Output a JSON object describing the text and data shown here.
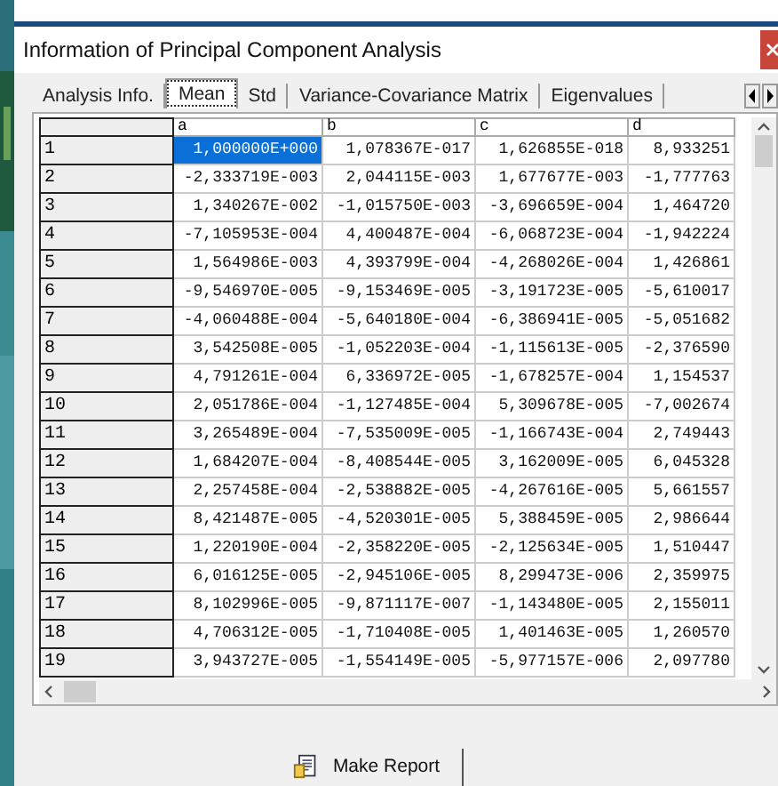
{
  "window": {
    "title": "Information of Principal Component Analysis"
  },
  "tabs": [
    {
      "label": "Analysis Info.",
      "selected": false
    },
    {
      "label": "Mean",
      "selected": true
    },
    {
      "label": "Std",
      "selected": false
    },
    {
      "label": "Variance-Covariance Matrix",
      "selected": false
    },
    {
      "label": "Eigenvalues",
      "selected": false
    }
  ],
  "table": {
    "columns": [
      "a",
      "b",
      "c",
      "d"
    ],
    "rows": [
      {
        "header": "1",
        "cells": [
          {
            "text": "1,000000E+000",
            "selected": true
          },
          {
            "text": "1,078367E-017",
            "selected": false
          },
          {
            "text": "1,626855E-018",
            "selected": false
          },
          {
            "text": "8,933251",
            "selected": false
          }
        ]
      },
      {
        "header": "2",
        "cells": [
          {
            "text": "-2,333719E-003",
            "selected": false
          },
          {
            "text": "2,044115E-003",
            "selected": false
          },
          {
            "text": "1,677677E-003",
            "selected": false
          },
          {
            "text": "-1,777763",
            "selected": false
          }
        ]
      },
      {
        "header": "3",
        "cells": [
          {
            "text": "1,340267E-002",
            "selected": false
          },
          {
            "text": "-1,015750E-003",
            "selected": false
          },
          {
            "text": "-3,696659E-004",
            "selected": false
          },
          {
            "text": "1,464720",
            "selected": false
          }
        ]
      },
      {
        "header": "4",
        "cells": [
          {
            "text": "-7,105953E-004",
            "selected": false
          },
          {
            "text": "4,400487E-004",
            "selected": false
          },
          {
            "text": "-6,068723E-004",
            "selected": false
          },
          {
            "text": "-1,942224",
            "selected": false
          }
        ]
      },
      {
        "header": "5",
        "cells": [
          {
            "text": "1,564986E-003",
            "selected": false
          },
          {
            "text": "4,393799E-004",
            "selected": false
          },
          {
            "text": "-4,268026E-004",
            "selected": false
          },
          {
            "text": "1,426861",
            "selected": false
          }
        ]
      },
      {
        "header": "6",
        "cells": [
          {
            "text": "-9,546970E-005",
            "selected": false
          },
          {
            "text": "-9,153469E-005",
            "selected": false
          },
          {
            "text": "-3,191723E-005",
            "selected": false
          },
          {
            "text": "-5,610017",
            "selected": false
          }
        ]
      },
      {
        "header": "7",
        "cells": [
          {
            "text": "-4,060488E-004",
            "selected": false
          },
          {
            "text": "-5,640180E-004",
            "selected": false
          },
          {
            "text": "-6,386941E-005",
            "selected": false
          },
          {
            "text": "-5,051682",
            "selected": false
          }
        ]
      },
      {
        "header": "8",
        "cells": [
          {
            "text": "3,542508E-005",
            "selected": false
          },
          {
            "text": "-1,052203E-004",
            "selected": false
          },
          {
            "text": "-1,115613E-005",
            "selected": false
          },
          {
            "text": "-2,376590",
            "selected": false
          }
        ]
      },
      {
        "header": "9",
        "cells": [
          {
            "text": "4,791261E-004",
            "selected": false
          },
          {
            "text": "6,336972E-005",
            "selected": false
          },
          {
            "text": "-1,678257E-004",
            "selected": false
          },
          {
            "text": "1,154537",
            "selected": false
          }
        ]
      },
      {
        "header": "10",
        "cells": [
          {
            "text": "2,051786E-004",
            "selected": false
          },
          {
            "text": "-1,127485E-004",
            "selected": false
          },
          {
            "text": "5,309678E-005",
            "selected": false
          },
          {
            "text": "-7,002674",
            "selected": false
          }
        ]
      },
      {
        "header": "11",
        "cells": [
          {
            "text": "3,265489E-004",
            "selected": false
          },
          {
            "text": "-7,535009E-005",
            "selected": false
          },
          {
            "text": "-1,166743E-004",
            "selected": false
          },
          {
            "text": "2,749443",
            "selected": false
          }
        ]
      },
      {
        "header": "12",
        "cells": [
          {
            "text": "1,684207E-004",
            "selected": false
          },
          {
            "text": "-8,408544E-005",
            "selected": false
          },
          {
            "text": "3,162009E-005",
            "selected": false
          },
          {
            "text": "6,045328",
            "selected": false
          }
        ]
      },
      {
        "header": "13",
        "cells": [
          {
            "text": "2,257458E-004",
            "selected": false
          },
          {
            "text": "-2,538882E-005",
            "selected": false
          },
          {
            "text": "-4,267616E-005",
            "selected": false
          },
          {
            "text": "5,661557",
            "selected": false
          }
        ]
      },
      {
        "header": "14",
        "cells": [
          {
            "text": "8,421487E-005",
            "selected": false
          },
          {
            "text": "-4,520301E-005",
            "selected": false
          },
          {
            "text": "5,388459E-005",
            "selected": false
          },
          {
            "text": "2,986644",
            "selected": false
          }
        ]
      },
      {
        "header": "15",
        "cells": [
          {
            "text": "1,220190E-004",
            "selected": false
          },
          {
            "text": "-2,358220E-005",
            "selected": false
          },
          {
            "text": "-2,125634E-005",
            "selected": false
          },
          {
            "text": "1,510447",
            "selected": false
          }
        ]
      },
      {
        "header": "16",
        "cells": [
          {
            "text": "6,016125E-005",
            "selected": false
          },
          {
            "text": "-2,945106E-005",
            "selected": false
          },
          {
            "text": "8,299473E-006",
            "selected": false
          },
          {
            "text": "2,359975",
            "selected": false
          }
        ]
      },
      {
        "header": "17",
        "cells": [
          {
            "text": "8,102996E-005",
            "selected": false
          },
          {
            "text": "-9,871117E-007",
            "selected": false
          },
          {
            "text": "-1,143480E-005",
            "selected": false
          },
          {
            "text": "2,155011",
            "selected": false
          }
        ]
      },
      {
        "header": "18",
        "cells": [
          {
            "text": "4,706312E-005",
            "selected": false
          },
          {
            "text": "-1,710408E-005",
            "selected": false
          },
          {
            "text": "1,401463E-005",
            "selected": false
          },
          {
            "text": "1,260570",
            "selected": false
          }
        ]
      },
      {
        "header": "19",
        "cells": [
          {
            "text": "3,943727E-005",
            "selected": false
          },
          {
            "text": "-1,554149E-005",
            "selected": false
          },
          {
            "text": "-5,977157E-006",
            "selected": false
          },
          {
            "text": "2,097780",
            "selected": false
          }
        ]
      }
    ]
  },
  "buttons": [
    {
      "label": "Make Report"
    }
  ]
}
